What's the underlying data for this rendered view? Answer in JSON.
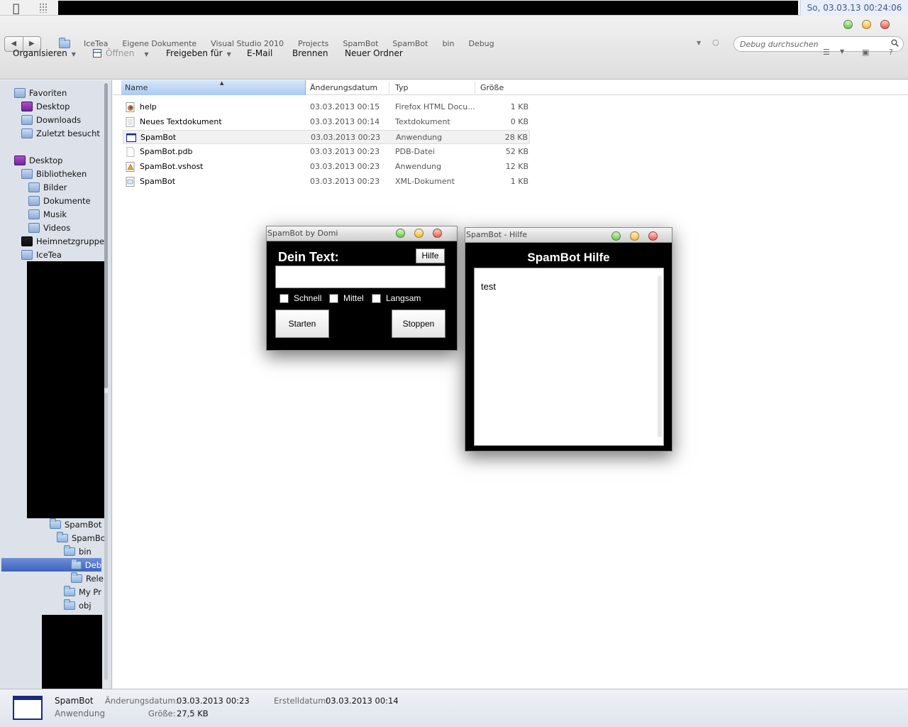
{
  "menubar": {
    "clock": "So, 03.03.13 00:24:06"
  },
  "breadcrumb": [
    "IceTea",
    "Eigene Dokumente",
    "Visual Studio 2010",
    "Projects",
    "SpamBot",
    "SpamBot",
    "bin",
    "Debug"
  ],
  "search": {
    "placeholder": "Debug durchsuchen"
  },
  "toolbar": {
    "organize": "Organisieren",
    "open": "Öffnen",
    "share": "Freigeben für",
    "email": "E-Mail",
    "burn": "Brennen",
    "new_folder": "Neuer Ordner"
  },
  "sidebar": {
    "favorites": "Favoriten",
    "fav_desktop": "Desktop",
    "downloads": "Downloads",
    "recent": "Zuletzt besucht",
    "desktop": "Desktop",
    "libraries": "Bibliotheken",
    "pictures": "Bilder",
    "documents": "Dokumente",
    "music": "Musik",
    "videos": "Videos",
    "homegroup": "Heimnetzgruppe",
    "user": "IceTea",
    "tree": [
      "SpamBot",
      "SpamBo",
      "bin",
      "Deb",
      "Rele",
      "My Pr",
      "obj"
    ]
  },
  "columns": {
    "name": "Name",
    "date": "Änderungsdatum",
    "type": "Typ",
    "size": "Größe"
  },
  "files": [
    {
      "name": "help",
      "date": "03.03.2013 00:15",
      "type": "Firefox HTML Docu...",
      "size": "1 KB",
      "icon": "firefox-html-icon"
    },
    {
      "name": "Neues Textdokument",
      "date": "03.03.2013 00:14",
      "type": "Textdokument",
      "size": "0 KB",
      "icon": "text-file-icon"
    },
    {
      "name": "SpamBot",
      "date": "03.03.2013 00:23",
      "type": "Anwendung",
      "size": "28 KB",
      "icon": "application-icon"
    },
    {
      "name": "SpamBot.pdb",
      "date": "03.03.2013 00:23",
      "type": "PDB-Datei",
      "size": "52 KB",
      "icon": "blank-file-icon"
    },
    {
      "name": "SpamBot.vshost",
      "date": "03.03.2013 00:23",
      "type": "Anwendung",
      "size": "12 KB",
      "icon": "vshost-icon"
    },
    {
      "name": "SpamBot",
      "date": "03.03.2013 00:23",
      "type": "XML-Dokument",
      "size": "1 KB",
      "icon": "xml-file-icon"
    }
  ],
  "spambot_window": {
    "title": "SpamBot by Domi",
    "label": "Dein Text:",
    "help_button": "Hilfe",
    "text_value": "",
    "speed_fast": "Schnell",
    "speed_mid": "Mittel",
    "speed_slow": "Langsam",
    "start": "Starten",
    "stop": "Stoppen"
  },
  "help_window": {
    "title": "SpamBot - Hilfe",
    "heading": "SpamBot Hilfe",
    "body": "test"
  },
  "status": {
    "name": "SpamBot",
    "kind": "Anwendung",
    "modified_label": "Änderungsdatum:",
    "modified_value": "03.03.2013 00:23",
    "size_label": "Größe:",
    "size_value": "27,5 KB",
    "created_label": "Erstelldatum:",
    "created_value": "03.03.2013 00:14"
  },
  "colors": {
    "accent": "#3d63bd",
    "selection_header": "#a9caf1",
    "clock_text": "#3b5a8d"
  }
}
